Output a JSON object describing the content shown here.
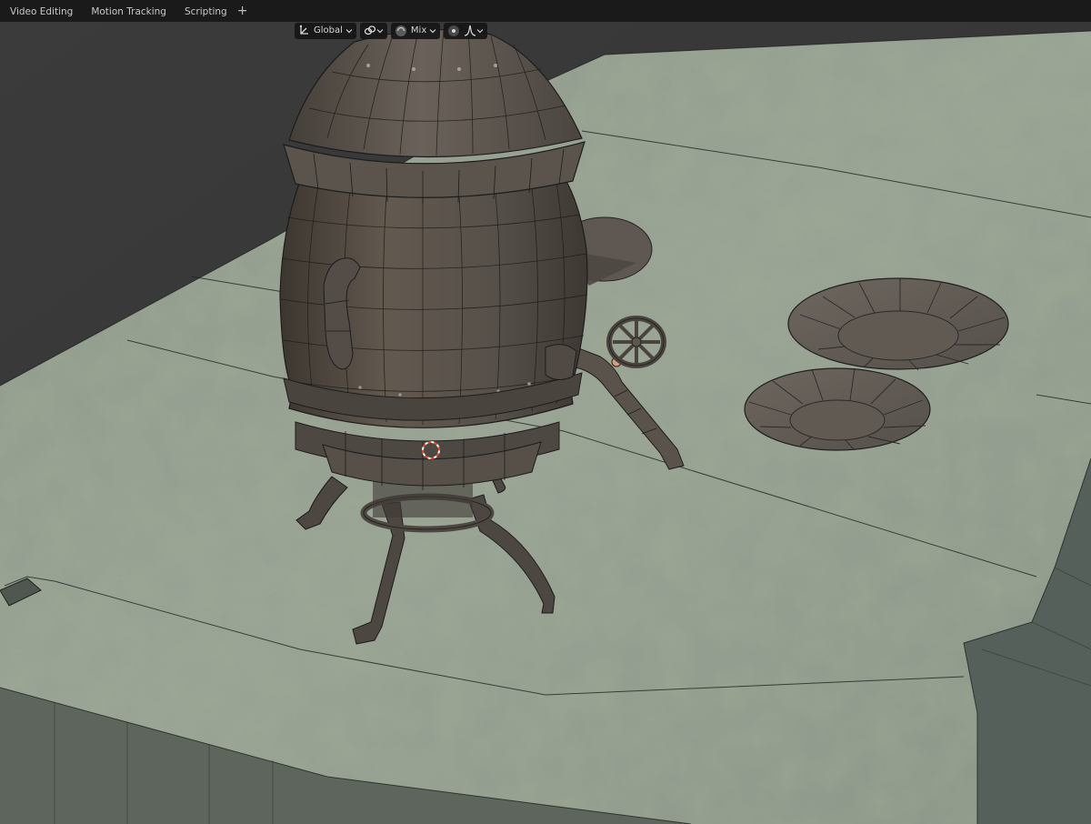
{
  "workspace_tabs": [
    {
      "label": "Video Editing"
    },
    {
      "label": "Motion Tracking"
    },
    {
      "label": "Scripting"
    }
  ],
  "viewport_header": {
    "transform_orientation": "Global",
    "snap_mode": "Mix"
  },
  "colors": {
    "topbar": "#1a1a1a",
    "viewport_bg": "#3a3a3a",
    "ground": "#8f9a8c",
    "metal": "#57504a",
    "cursor": "#e0502a"
  }
}
